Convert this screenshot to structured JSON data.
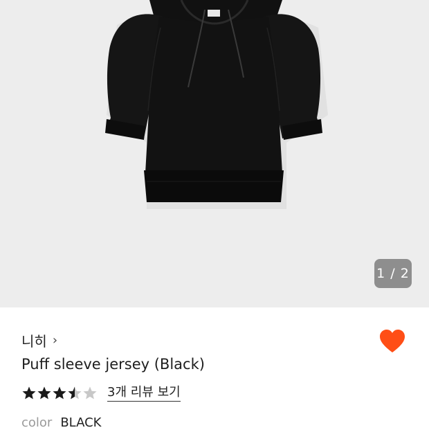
{
  "gallery": {
    "image_alt": "Black hooded puff sleeve jersey",
    "indicator": "1 / 2",
    "current": 1,
    "total": 2
  },
  "product": {
    "brand": "니히",
    "title": "Puff sleeve jersey (Black)",
    "rating": 3.5,
    "max_rating": 5,
    "review_link": "3개 리뷰 보기",
    "color_label": "color",
    "color_value": "BLACK",
    "wishlisted": true
  },
  "colors": {
    "accent": "#ff4e16",
    "gallery_bg": "#ededed",
    "star_filled": "#1a1a1a",
    "star_empty": "#c8c8c8"
  },
  "icons": {
    "brand_chevron": "chevron-right-icon",
    "wishlist": "heart-icon",
    "rating": "star-icon"
  }
}
